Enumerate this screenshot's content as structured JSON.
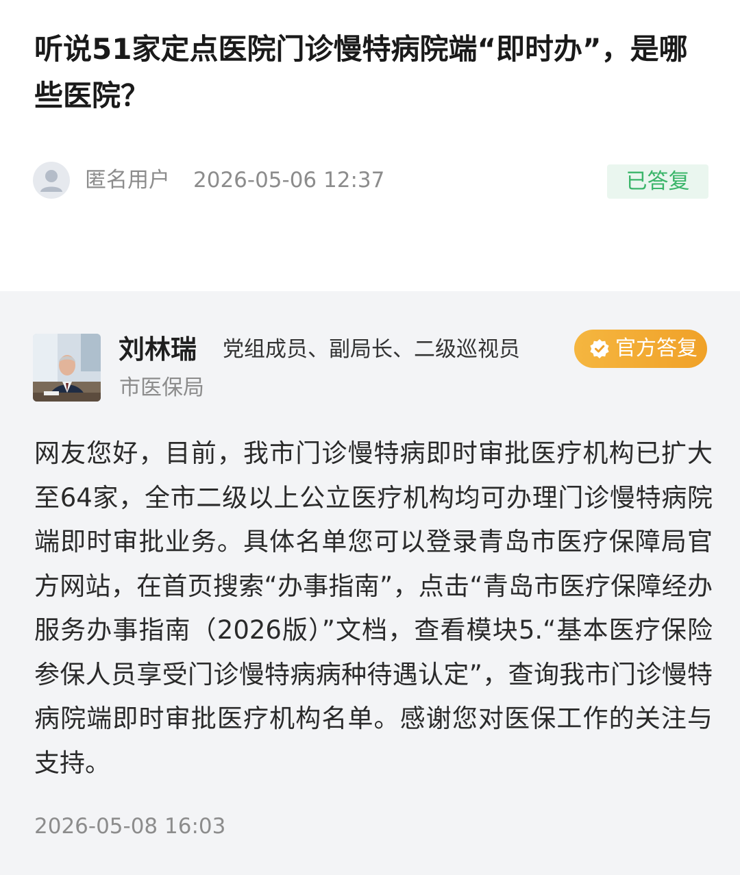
{
  "question": {
    "title": "听说51家定点医院门诊慢特病院端“即时办”，是哪些医院？",
    "asker": {
      "avatar_icon": "user-silhouette-icon",
      "name": "匿名用户",
      "time": "2026-05-06 12:37"
    },
    "status": "已答复",
    "status_color": "#3bb56a"
  },
  "answer": {
    "responder": {
      "name": "刘林瑞",
      "role": "党组成员、副局长、二级巡视员",
      "department": "市医保局"
    },
    "badge": {
      "icon": "verified-check-icon",
      "label": "官方答复",
      "color": "#f0a128"
    },
    "body": "网友您好，目前，我市门诊慢特病即时审批医疗机构已扩大至64家，全市二级以上公立医疗机构均可办理门诊慢特病院端即时审批业务。具体名单您可以登录青岛市医疗保障局官方网站，在首页搜索“办事指南”，点击“青岛市医疗保障经办服务办事指南（2026版）”文档，查看模块5.“基本医疗保险参保人员享受门诊慢特病病种待遇认定”，查询我市门诊慢特病院端即时审批医疗机构名单。感谢您对医保工作的关注与支持。",
    "time": "2026-05-08 16:03"
  }
}
